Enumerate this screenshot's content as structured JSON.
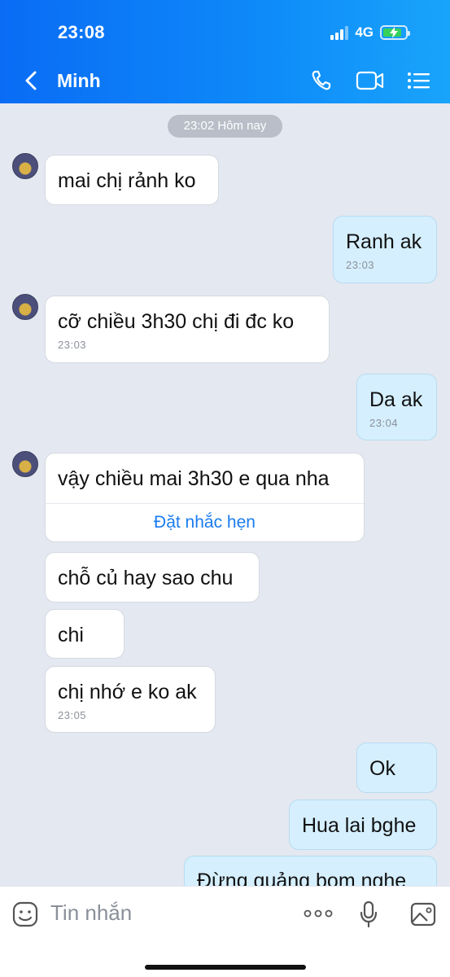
{
  "status_bar": {
    "time": "23:08",
    "network": "4G"
  },
  "header": {
    "contact_name": "Minh"
  },
  "date_separator": "23:02 Hôm nay",
  "messages": [
    {
      "text": "mai chị rảnh ko",
      "time": ""
    },
    {
      "text": "Ranh ak",
      "time": "23:03"
    },
    {
      "text": "cỡ chiều 3h30 chị đi đc ko",
      "time": "23:03"
    },
    {
      "text": "Da ak",
      "time": "23:04"
    },
    {
      "text": "vậy chiều mai 3h30 e qua nha",
      "time": "",
      "action": "Đặt nhắc hẹn"
    },
    {
      "text": "chỗ củ hay sao chu",
      "time": ""
    },
    {
      "text": "chi",
      "time": ""
    },
    {
      "text": "chị nhớ e ko ak",
      "time": "23:05"
    },
    {
      "text": "Ok",
      "time": ""
    },
    {
      "text": "Hua lai bghe",
      "time": ""
    },
    {
      "text": "Đừng quảng bom nghe",
      "time": ""
    }
  ],
  "composer": {
    "placeholder": "Tin nhắn"
  },
  "colors": {
    "header": "#0e8bf9",
    "my_bubble": "#d5efff",
    "their_bubble": "#ffffff",
    "link": "#1a7cf0"
  }
}
